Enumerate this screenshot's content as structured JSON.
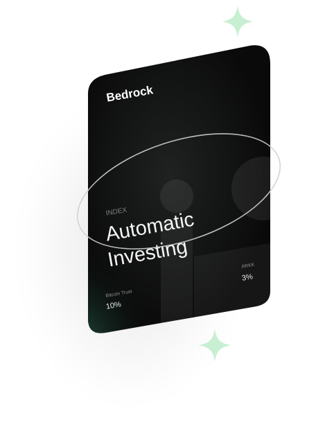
{
  "card": {
    "brand": "Bedrock",
    "index_label": "INDEX",
    "title_line1": "Automatic",
    "title_line2": "Investing",
    "holdings": [
      {
        "name": "Bitcoin Trust",
        "percent": "10%"
      },
      {
        "name": "ARKK",
        "percent": "3%"
      }
    ]
  },
  "colors": {
    "card_dark": "#0a0a0a",
    "card_green_glow": "#214a3d",
    "sparkle_green": "#c8efd2"
  },
  "icons": [
    "sparkle-icon",
    "sparkle-icon"
  ]
}
